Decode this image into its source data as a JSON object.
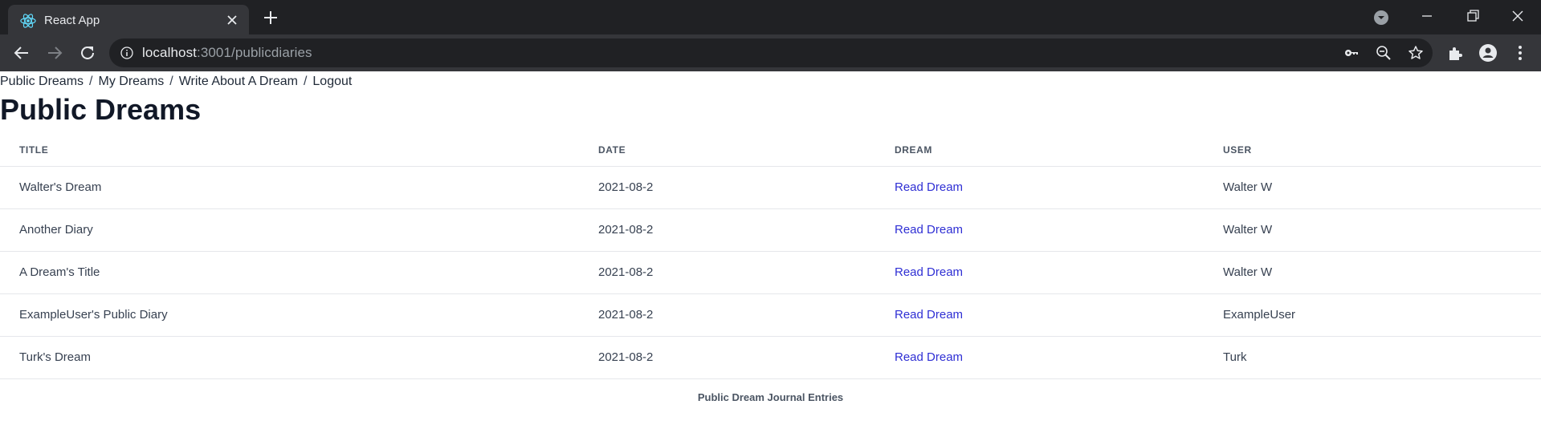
{
  "browser": {
    "tab_title": "React App",
    "url_host": "localhost",
    "url_rest": ":3001/publicdiaries"
  },
  "nav": {
    "items": [
      {
        "label": "Public Dreams"
      },
      {
        "label": "My Dreams"
      },
      {
        "label": "Write About A Dream"
      },
      {
        "label": "Logout"
      }
    ],
    "separator": "/"
  },
  "page": {
    "title": "Public Dreams"
  },
  "table": {
    "headers": [
      "TITLE",
      "DATE",
      "DREAM",
      "USER"
    ],
    "rows": [
      {
        "title": "Walter's Dream",
        "date": "2021-08-2",
        "dream": "Read Dream",
        "user": "Walter W"
      },
      {
        "title": "Another Diary",
        "date": "2021-08-2",
        "dream": "Read Dream",
        "user": "Walter W"
      },
      {
        "title": "A Dream's Title",
        "date": "2021-08-2",
        "dream": "Read Dream",
        "user": "Walter W"
      },
      {
        "title": "ExampleUser's Public Diary",
        "date": "2021-08-2",
        "dream": "Read Dream",
        "user": "ExampleUser"
      },
      {
        "title": "Turk's Dream",
        "date": "2021-08-2",
        "dream": "Read Dream",
        "user": "Turk"
      }
    ],
    "caption": "Public Dream Journal Entries"
  },
  "colors": {
    "link": "#2f2fd4",
    "chrome_dark": "#202124",
    "chrome_mid": "#35363a"
  },
  "icons": [
    "react-logo-icon",
    "close-icon",
    "plus-icon",
    "tab-search-icon",
    "minimize-icon",
    "restore-icon",
    "window-close-icon",
    "back-icon",
    "forward-icon",
    "reload-icon",
    "info-icon",
    "key-icon",
    "zoom-out-icon",
    "star-icon",
    "extensions-icon",
    "profile-icon",
    "kebab-menu-icon"
  ]
}
